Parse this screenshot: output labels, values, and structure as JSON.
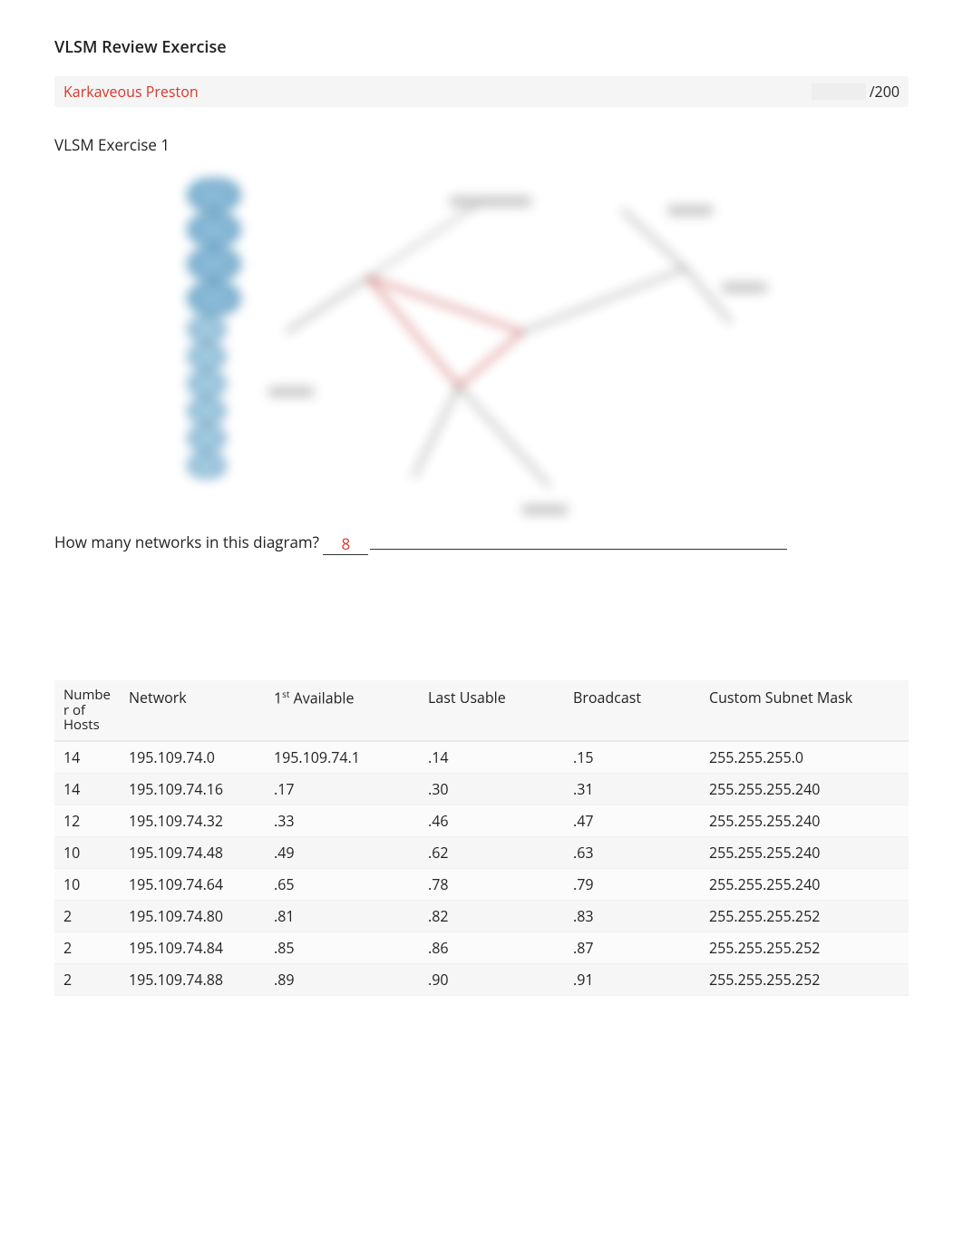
{
  "header": {
    "title": "VLSM Review Exercise",
    "student_name": "Karkaveous Preston",
    "score_total": "/200"
  },
  "section": {
    "subtitle": "VLSM Exercise 1",
    "question_prefix": "How many networks in this diagram? ",
    "answer": "8"
  },
  "table": {
    "headers": {
      "hosts": "Number of Hosts",
      "hosts_wrapped_1": "Numbe",
      "hosts_wrapped_2": "r of",
      "hosts_wrapped_3": "Hosts",
      "network": "Network",
      "first": "1ˢᵗ Available",
      "first_plain": "1st Available",
      "last": "Last Usable",
      "broadcast": "Broadcast",
      "mask": "Custom Subnet Mask"
    },
    "rows": [
      {
        "hosts": "14",
        "network": "195.109.74.0",
        "first": "195.109.74.1",
        "last": ".14",
        "broadcast": ".15",
        "mask": "255.255.255.0"
      },
      {
        "hosts": "14",
        "network": "195.109.74.16",
        "first": ".17",
        "last": ".30",
        "broadcast": ".31",
        "mask": "255.255.255.240"
      },
      {
        "hosts": "12",
        "network": "195.109.74.32",
        "first": ".33",
        "last": ".46",
        "broadcast": ".47",
        "mask": "255.255.255.240"
      },
      {
        "hosts": "10",
        "network": "195.109.74.48",
        "first": ".49",
        "last": ".62",
        "broadcast": ".63",
        "mask": "255.255.255.240"
      },
      {
        "hosts": "10",
        "network": "195.109.74.64",
        "first": ".65",
        "last": ".78",
        "broadcast": ".79",
        "mask": "255.255.255.240"
      },
      {
        "hosts": "2",
        "network": "195.109.74.80",
        "first": ".81",
        "last": ".82",
        "broadcast": ".83",
        "mask": "255.255.255.252"
      },
      {
        "hosts": "2",
        "network": "195.109.74.84",
        "first": ".85",
        "last": ".86",
        "broadcast": ".87",
        "mask": "255.255.255.252"
      },
      {
        "hosts": "2",
        "network": "195.109.74.88",
        "first": ".89",
        "last": ".90",
        "broadcast": ".91",
        "mask": "255.255.255.252"
      }
    ]
  }
}
